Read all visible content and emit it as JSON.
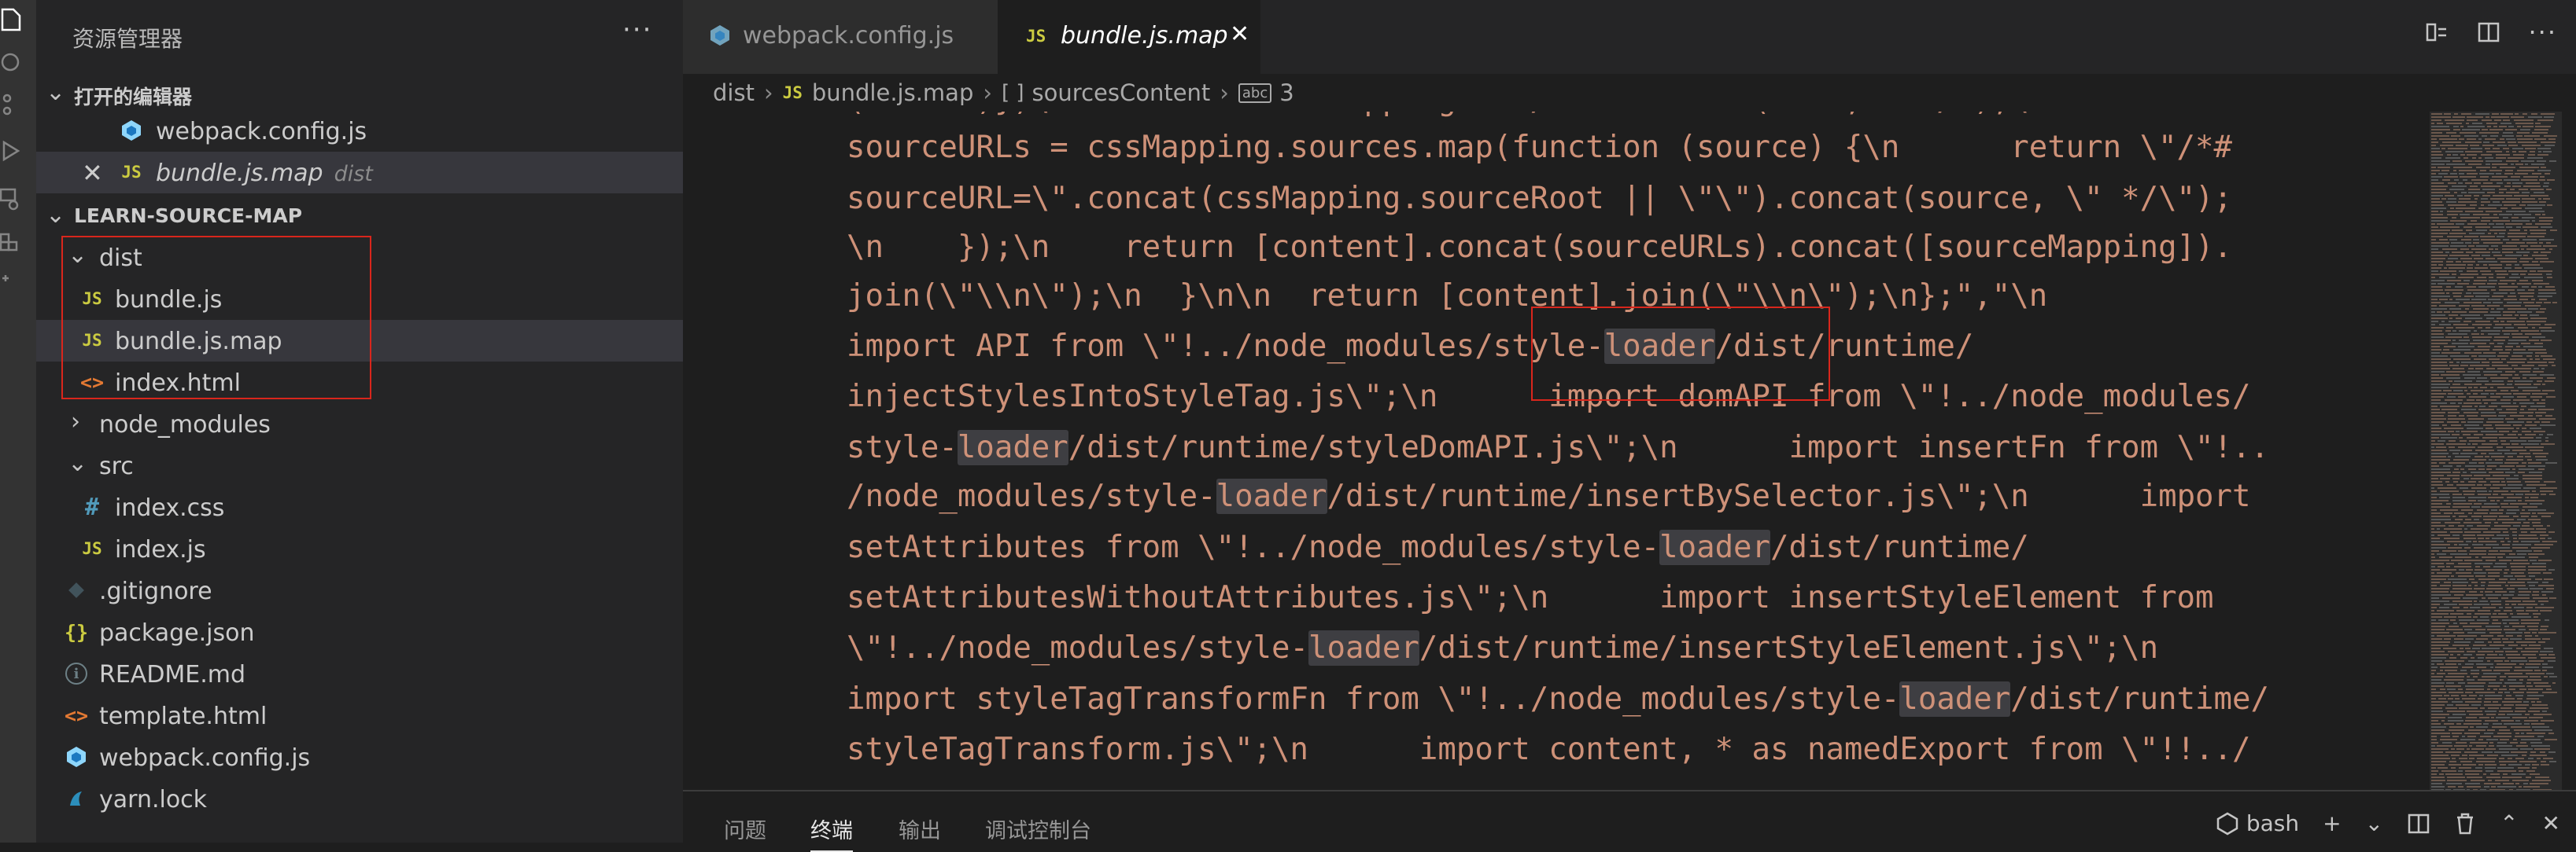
{
  "sidebar": {
    "title": "资源管理器",
    "more": "···",
    "open_editors": {
      "label": "打开的编辑器",
      "items": [
        {
          "name": "webpack.config.js",
          "icon": "webpack-config-icon"
        },
        {
          "name": "bundle.js.map",
          "description": "dist",
          "icon": "js-file-icon"
        }
      ]
    },
    "project": {
      "label": "LEARN-SOURCE-MAP",
      "tree": [
        {
          "name": "dist",
          "kind": "folder",
          "expanded": true
        },
        {
          "name": "bundle.js",
          "kind": "js"
        },
        {
          "name": "bundle.js.map",
          "kind": "js"
        },
        {
          "name": "index.html",
          "kind": "html"
        },
        {
          "name": "node_modules",
          "kind": "folder",
          "expanded": false
        },
        {
          "name": "src",
          "kind": "folder",
          "expanded": true
        },
        {
          "name": "index.css",
          "kind": "css"
        },
        {
          "name": "index.js",
          "kind": "js"
        },
        {
          "name": ".gitignore",
          "kind": "git"
        },
        {
          "name": "package.json",
          "kind": "json"
        },
        {
          "name": "README.md",
          "kind": "info"
        },
        {
          "name": "template.html",
          "kind": "html"
        },
        {
          "name": "webpack.config.js",
          "kind": "webpack"
        },
        {
          "name": "yarn.lock",
          "kind": "yarn"
        }
      ]
    }
  },
  "tabs": [
    {
      "label": "webpack.config.js",
      "active": false
    },
    {
      "label": "bundle.js.map",
      "active": true,
      "badge": "JS"
    }
  ],
  "breadcrumb": {
    "items": [
      "dist",
      "bundle.js.map",
      "sourcesContent",
      "3"
    ],
    "js_badge": "JS",
    "array_badge": "[ ]",
    "string_badge": "abc"
  },
  "editor": {
    "lines": [
      "(source)})\\n    var sourceMapping = \"/*# \".concat(data, \" */\");\\n    var",
      "sourceURLs = cssMapping.sources.map(function (source) {\\n      return \\\"/*#",
      "sourceURL=\\\".concat(cssMapping.sourceRoot || \\\"\\\").concat(source, \\\" */\\\");",
      "\\n    });\\n    return [content].concat(sourceURLs).concat([sourceMapping]).",
      "join(\\\"\\\\n\\\");\\n  }\\n\\n  return [content].join(\\\"\\\\n\\\");\\n};\",\"\\n",
      "import API from \\\"!../node_modules/style-loader/dist/runtime/",
      "injectStylesIntoStyleTag.js\\\";\\n      import domAPI from \\\"!../node_modules/",
      "style-loader/dist/runtime/styleDomAPI.js\\\";\\n      import insertFn from \\\"!..",
      "/node_modules/style-loader/dist/runtime/insertBySelector.js\\\";\\n      import",
      "setAttributes from \\\"!../node_modules/style-loader/dist/runtime/",
      "setAttributesWithoutAttributes.js\\\";\\n      import insertStyleElement from",
      "\\\"!../node_modules/style-loader/dist/runtime/insertStyleElement.js\\\";\\n",
      "import styleTagTransformFn from \\\"!../node_modules/style-loader/dist/runtime/",
      "styleTagTransform.js\\\";\\n      import content, * as namedExport from \\\"!!../"
    ],
    "highlight_word": "loader"
  },
  "panel": {
    "tabs": [
      "问题",
      "终端",
      "输出",
      "调试控制台"
    ],
    "active_tab": "终端",
    "terminal_name": "bash"
  },
  "colors": {
    "string": "#ce9178",
    "accent_red": "#d9261c",
    "js_yellow": "#cbcb41"
  }
}
